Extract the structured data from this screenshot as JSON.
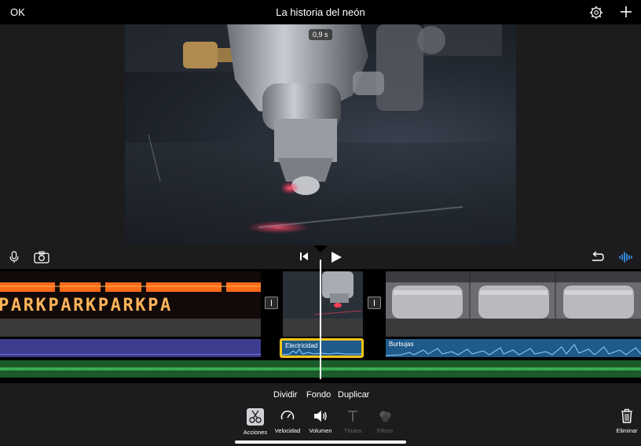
{
  "header": {
    "ok_label": "OK",
    "title": "La historia del neón",
    "settings_icon": "gear-icon",
    "add_icon": "plus-icon"
  },
  "viewer": {
    "time_badge": "0,9 s"
  },
  "controls": {
    "mic_icon": "microphone-icon",
    "camera_icon": "camera-icon",
    "rewind_icon": "skip-to-start-icon",
    "play_icon": "play-icon",
    "undo_icon": "undo-icon",
    "waveform_icon": "waveform-icon"
  },
  "timeline": {
    "clips": [
      {
        "name": "park-sign-clip"
      },
      {
        "name": "laser-clip"
      },
      {
        "name": "machine-clip"
      }
    ],
    "park_text": "PARKPARKPARKPA",
    "audio_clips": [
      {
        "label": "Electricidad"
      },
      {
        "label": "Burbujas"
      }
    ]
  },
  "actions": {
    "split": "Dividir",
    "background": "Fondo",
    "duplicate": "Duplicar"
  },
  "toolbar": {
    "items": [
      {
        "label": "Acciones",
        "icon": "scissors-icon",
        "active": true
      },
      {
        "label": "Velocidad",
        "icon": "speedometer-icon"
      },
      {
        "label": "Volumen",
        "icon": "speaker-icon"
      },
      {
        "label": "Títulos",
        "icon": "text-icon",
        "disabled": true
      },
      {
        "label": "Filtros",
        "icon": "filters-icon",
        "disabled": true
      }
    ],
    "delete_label": "Eliminar",
    "delete_icon": "trash-icon"
  },
  "colors": {
    "accent_yellow": "#f5c518",
    "audio_purple": "#3e3c8e",
    "audio_blue": "#1f5a8a",
    "music_green": "#1c5a2a"
  }
}
